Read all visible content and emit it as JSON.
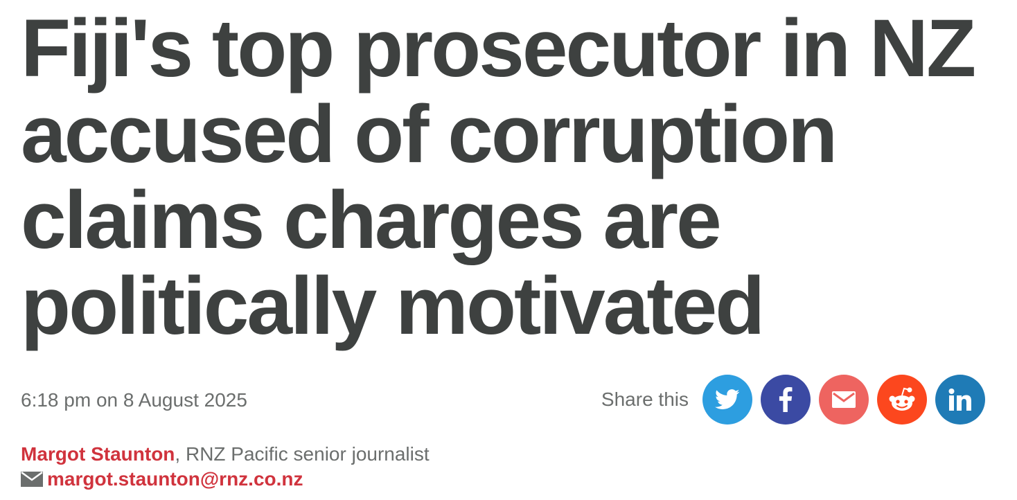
{
  "article": {
    "headline_lines": [
      "Fiji's top prosecutor in NZ",
      "accused of corruption",
      "claims charges are",
      "politically motivated"
    ],
    "timestamp": "6:18 pm on 8 August 2025"
  },
  "share": {
    "label": "Share this",
    "buttons": [
      {
        "name": "twitter",
        "icon": "twitter-icon",
        "color": "#2d9ee0"
      },
      {
        "name": "facebook",
        "icon": "facebook-icon",
        "color": "#3b4aa3"
      },
      {
        "name": "email",
        "icon": "mail-icon",
        "color": "#ee6460"
      },
      {
        "name": "reddit",
        "icon": "reddit-icon",
        "color": "#fc471e"
      },
      {
        "name": "linkedin",
        "icon": "linkedin-icon",
        "color": "#1f7bb6"
      }
    ]
  },
  "byline": {
    "author": "Margot Staunton",
    "role": ", RNZ Pacific senior journalist",
    "email": "margot.staunton@rnz.co.nz"
  },
  "colors": {
    "headline": "#3e4140",
    "meta_text": "#6b6e6d",
    "accent_red": "#d0333d"
  }
}
